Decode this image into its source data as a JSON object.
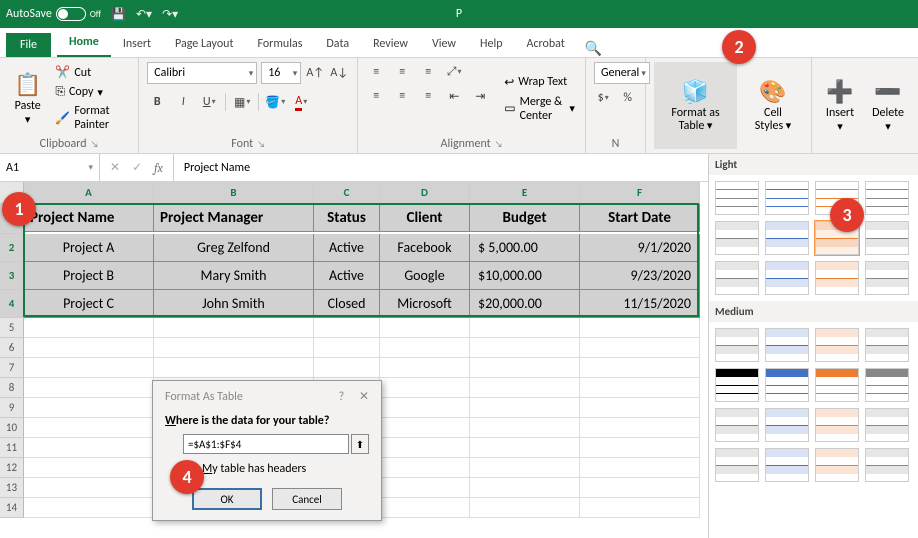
{
  "titlebar": {
    "autosave_label": "AutoSave",
    "autosave_state": "Off",
    "doc_title": "P"
  },
  "tabs": {
    "file": "File",
    "home": "Home",
    "insert": "Insert",
    "page_layout": "Page Layout",
    "formulas": "Formulas",
    "data": "Data",
    "review": "Review",
    "view": "View",
    "help": "Help",
    "acrobat": "Acrobat"
  },
  "ribbon": {
    "clipboard": {
      "label": "Clipboard",
      "paste": "Paste",
      "cut": "Cut",
      "copy": "Copy",
      "format_painter": "Format Painter"
    },
    "font": {
      "label": "Font",
      "name": "Calibri",
      "size": "16"
    },
    "alignment": {
      "label": "Alignment",
      "wrap": "Wrap Text",
      "merge": "Merge & Center"
    },
    "number": {
      "label": "N",
      "format": "General",
      "currency": "$"
    },
    "styles": {
      "format_table": "Format as Table",
      "cell_styles": "Cell Styles"
    },
    "cells": {
      "insert": "Insert",
      "delete": "Delete"
    }
  },
  "namebox": {
    "ref": "A1"
  },
  "formula": {
    "value": "Project Name"
  },
  "columns": [
    "A",
    "B",
    "C",
    "D",
    "E",
    "F"
  ],
  "row_numbers": [
    "1",
    "2",
    "3",
    "4",
    "5",
    "6",
    "7",
    "8",
    "9",
    "10",
    "11",
    "12",
    "13",
    "14"
  ],
  "table": {
    "headers": [
      "Project Name",
      "Project Manager",
      "Status",
      "Client",
      "Budget",
      "Start Date"
    ],
    "rows": [
      [
        "Project A",
        "Greg Zelfond",
        "Active",
        "Facebook",
        "$  5,000.00",
        "9/1/2020"
      ],
      [
        "Project B",
        "Mary Smith",
        "Active",
        "Google",
        "$10,000.00",
        "9/23/2020"
      ],
      [
        "Project C",
        "John Smith",
        "Closed",
        "Microsoft",
        "$20,000.00",
        "11/15/2020"
      ]
    ]
  },
  "gallery": {
    "light": "Light",
    "medium": "Medium"
  },
  "dialog": {
    "title": "Format As Table",
    "question": "Where is the data for your table?",
    "range": "=$A$1:$F$4",
    "headers_label": "My table has headers",
    "ok": "OK",
    "cancel": "Cancel"
  },
  "callouts": {
    "c1": "1",
    "c2": "2",
    "c3": "3",
    "c4": "4"
  }
}
